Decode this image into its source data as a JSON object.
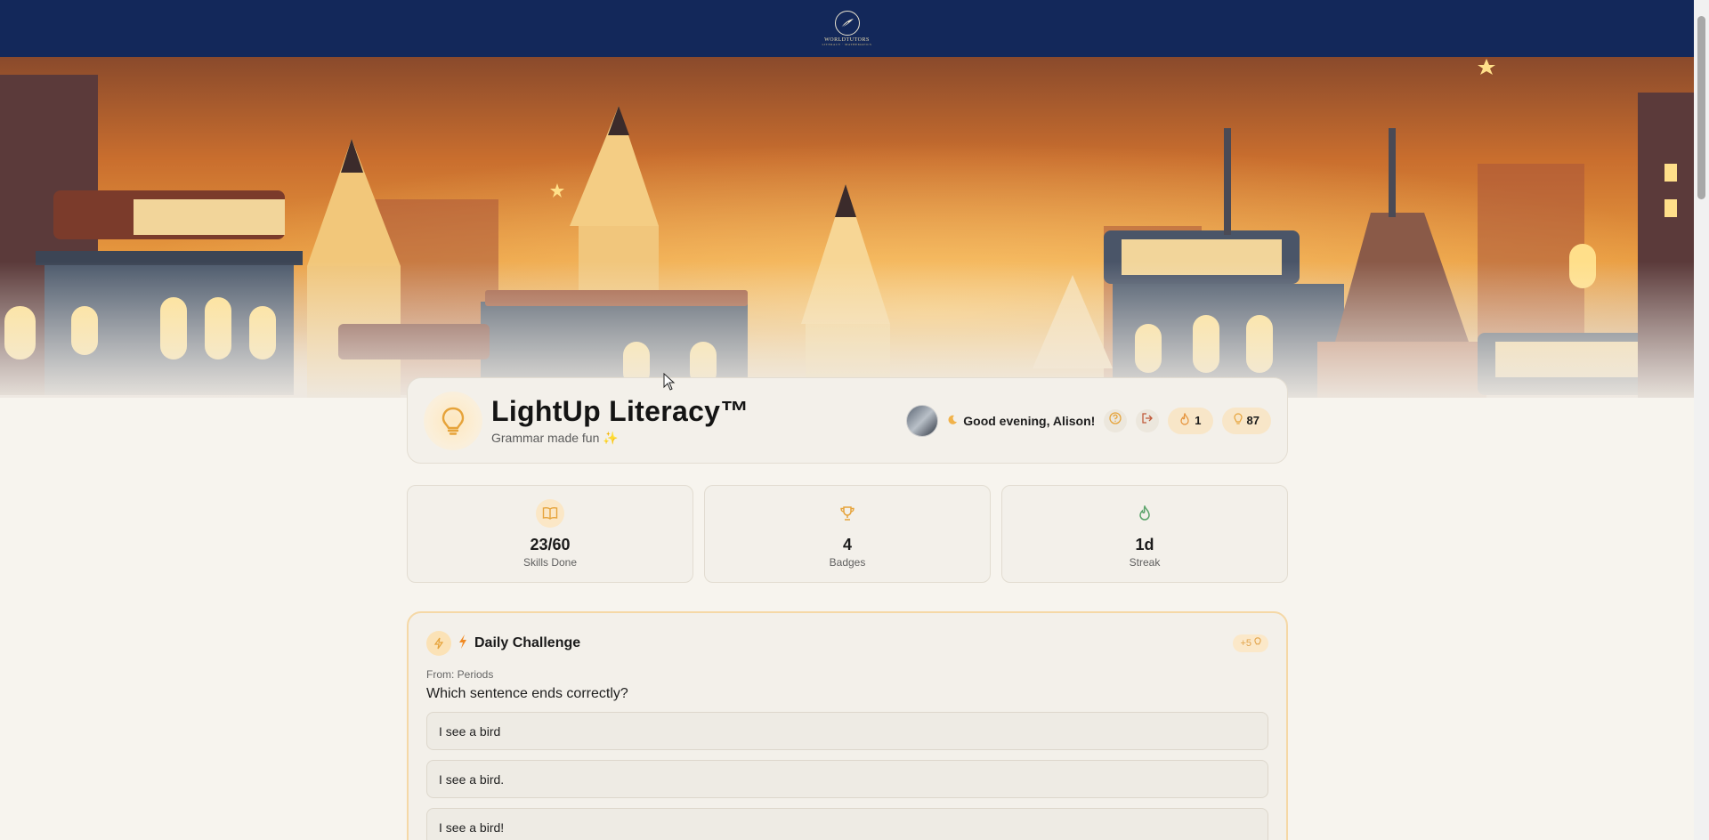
{
  "brand": {
    "name": "WORLDTUTORS",
    "tagline": "LITERACY · MATHEMATICS"
  },
  "header": {
    "title": "LightUp Literacy™",
    "subtitle": "Grammar made fun ✨",
    "greeting": "Good evening, Alison!",
    "streak_count": "1",
    "points_count": "87"
  },
  "stats": [
    {
      "icon": "book-open-icon",
      "value": "23/60",
      "label": "Skills Done"
    },
    {
      "icon": "trophy-icon",
      "value": "4",
      "label": "Badges"
    },
    {
      "icon": "flame-icon",
      "value": "1d",
      "label": "Streak"
    }
  ],
  "challenge": {
    "title": "Daily Challenge",
    "reward": "+5",
    "from": "From: Periods",
    "question": "Which sentence ends correctly?",
    "options": [
      "I see a bird",
      "I see a bird.",
      "I see a bird!"
    ]
  },
  "colors": {
    "navy": "#13285a",
    "accent": "#f0a43a",
    "green": "#5aa36a",
    "background": "#f7f4ee"
  }
}
